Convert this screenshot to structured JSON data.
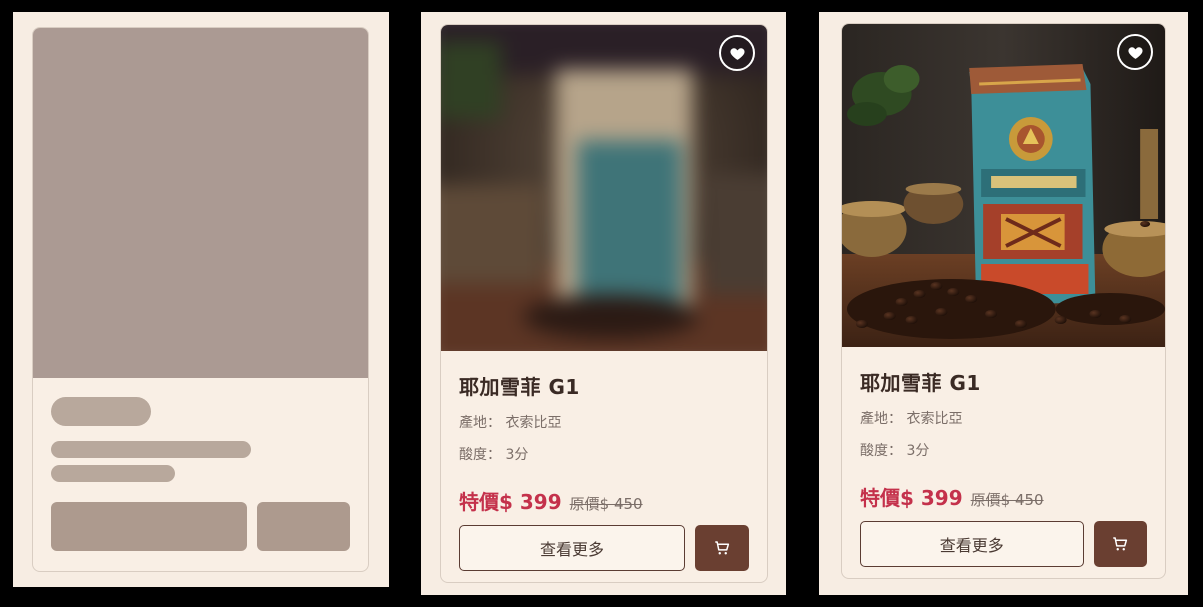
{
  "products": [
    {
      "name": "耶加雪菲 G1",
      "origin_label": "產地：",
      "origin_value": "衣索比亞",
      "acidity_label": "酸度：",
      "acidity_value": "3分",
      "special_price": "特價$ 399",
      "original_price": "原價$ 450",
      "more_label": "查看更多",
      "image_state": "blurred-loading"
    },
    {
      "name": "耶加雪菲 G1",
      "origin_label": "產地：",
      "origin_value": "衣索比亞",
      "acidity_label": "酸度：",
      "acidity_value": "3分",
      "special_price": "特價$ 399",
      "original_price": "原價$ 450",
      "more_label": "查看更多",
      "image_state": "loaded"
    }
  ],
  "icons": {
    "favorite": "heart-icon",
    "cart": "cart-icon"
  },
  "colors": {
    "card_background": "#f9efe5",
    "skeleton": "#ab9a93",
    "special_price": "#c4314b",
    "cart_button": "#6a3f31"
  }
}
